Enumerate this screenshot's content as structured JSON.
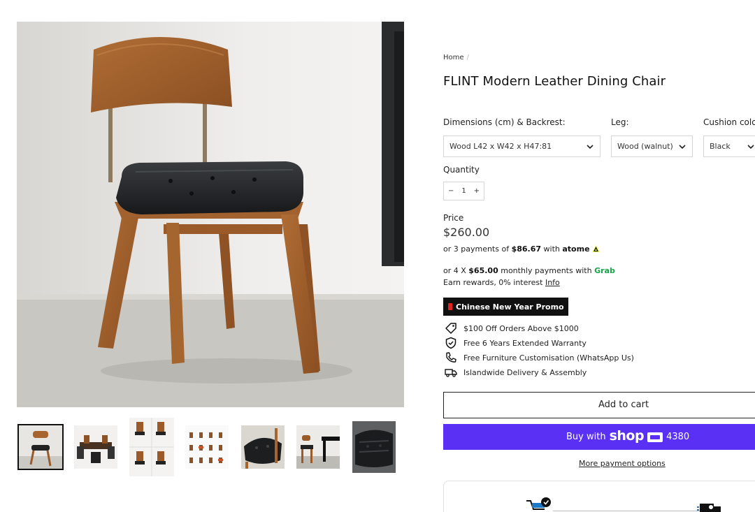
{
  "breadcrumb": {
    "home": "Home",
    "separator": "/"
  },
  "product": {
    "title": "FLINT Modern Leather Dining Chair",
    "options": [
      {
        "label": "Dimensions (cm) & Backrest:",
        "value": "Wood L42 x W42 x H47:81"
      },
      {
        "label": "Leg:",
        "value": "Wood (walnut)"
      },
      {
        "label": "Cushion colo",
        "value": "Black"
      }
    ],
    "quantity_label": "Quantity",
    "quantity": {
      "minus": "−",
      "value": "1",
      "plus": "+"
    },
    "price_label": "Price",
    "price": "$260.00"
  },
  "payments": {
    "atome": {
      "prefix": "or 3 payments of ",
      "amount": "$86.67",
      "mid": " with ",
      "brand": "atome"
    },
    "grab": {
      "prefix": "or 4 X ",
      "amount": "$65.00",
      "mid": " monthly payments with ",
      "brand": "Grab"
    },
    "rewards": {
      "text": "Earn rewards, 0% interest ",
      "link": "Info"
    }
  },
  "promo": {
    "label": "Chinese New Year Promo"
  },
  "perks": [
    {
      "icon": "price-tag-icon",
      "text": "$100 Off Orders Above $1000"
    },
    {
      "icon": "shield-check-icon",
      "text": "Free 6 Years Extended Warranty"
    },
    {
      "icon": "phone-icon",
      "text": "Free Furniture Customisation (WhatsApp Us)"
    },
    {
      "icon": "truck-icon",
      "text": "Islandwide Delivery & Assembly"
    }
  ],
  "buttons": {
    "add_to_cart": "Add to cart",
    "buy_with": "Buy with",
    "shop_brand": "shop",
    "shop_points": "4380",
    "more_options": "More payment options"
  },
  "colors": {
    "shop_purple": "#5a31f4",
    "grab_green": "#19a34a",
    "promo_bg": "#111111",
    "walnut": "#9c5a2c"
  },
  "thumbnails": [
    "chair-side-photo",
    "dining-set-photo",
    "chair-grid-photo",
    "chair-variants-photo",
    "cushion-closeup-photo",
    "chair-table-photo",
    "cushion-detail-photo"
  ]
}
